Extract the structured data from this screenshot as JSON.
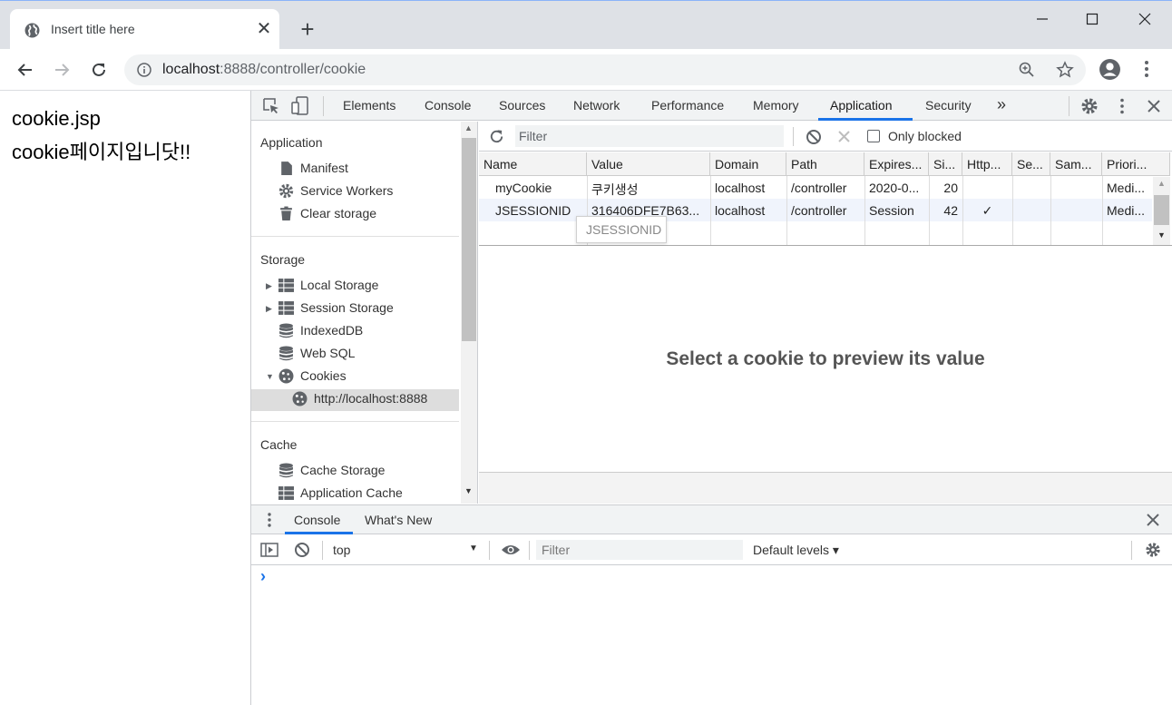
{
  "browser": {
    "tab_title": "Insert title here",
    "tab_close": "✕",
    "new_tab": "+",
    "url_host": "localhost",
    "url_rest": ":8888/controller/cookie"
  },
  "page": {
    "line1": "cookie.jsp",
    "line2": "cookie페이지입니닷!!"
  },
  "devtools": {
    "tabs": [
      "Elements",
      "Console",
      "Sources",
      "Network",
      "Performance",
      "Memory",
      "Application",
      "Security"
    ],
    "more_tabs": "»",
    "close": "✕",
    "sidebar": {
      "application_header": "Application",
      "application_items": [
        "Manifest",
        "Service Workers",
        "Clear storage"
      ],
      "storage_header": "Storage",
      "storage_items": [
        "Local Storage",
        "Session Storage",
        "IndexedDB",
        "Web SQL",
        "Cookies"
      ],
      "cookies_child": "http://localhost:8888",
      "cache_header": "Cache",
      "cache_items": [
        "Cache Storage",
        "Application Cache"
      ]
    },
    "cookies": {
      "filter_placeholder": "Filter",
      "only_blocked": "Only blocked",
      "columns": [
        "Name",
        "Value",
        "Domain",
        "Path",
        "Expires...",
        "Si...",
        "Http...",
        "Se...",
        "Sam...",
        "Priori..."
      ],
      "rows": [
        {
          "name": "myCookie",
          "value": "쿠키생성",
          "domain": "localhost",
          "path": "/controller",
          "expires": "2020-0...",
          "size": "20",
          "http": "",
          "secure": "",
          "same": "",
          "priority": "Medi..."
        },
        {
          "name": "JSESSIONID",
          "value": "316406DFE7B63...",
          "domain": "localhost",
          "path": "/controller",
          "expires": "Session",
          "size": "42",
          "http": "✓",
          "secure": "",
          "same": "",
          "priority": "Medi..."
        }
      ],
      "tooltip": "JSESSIONID",
      "preview_message": "Select a cookie to preview its value"
    },
    "drawer": {
      "tabs": [
        "Console",
        "What's New"
      ],
      "context": "top",
      "filter_placeholder": "Filter",
      "levels": "Default levels ▾",
      "prompt": "›"
    }
  }
}
